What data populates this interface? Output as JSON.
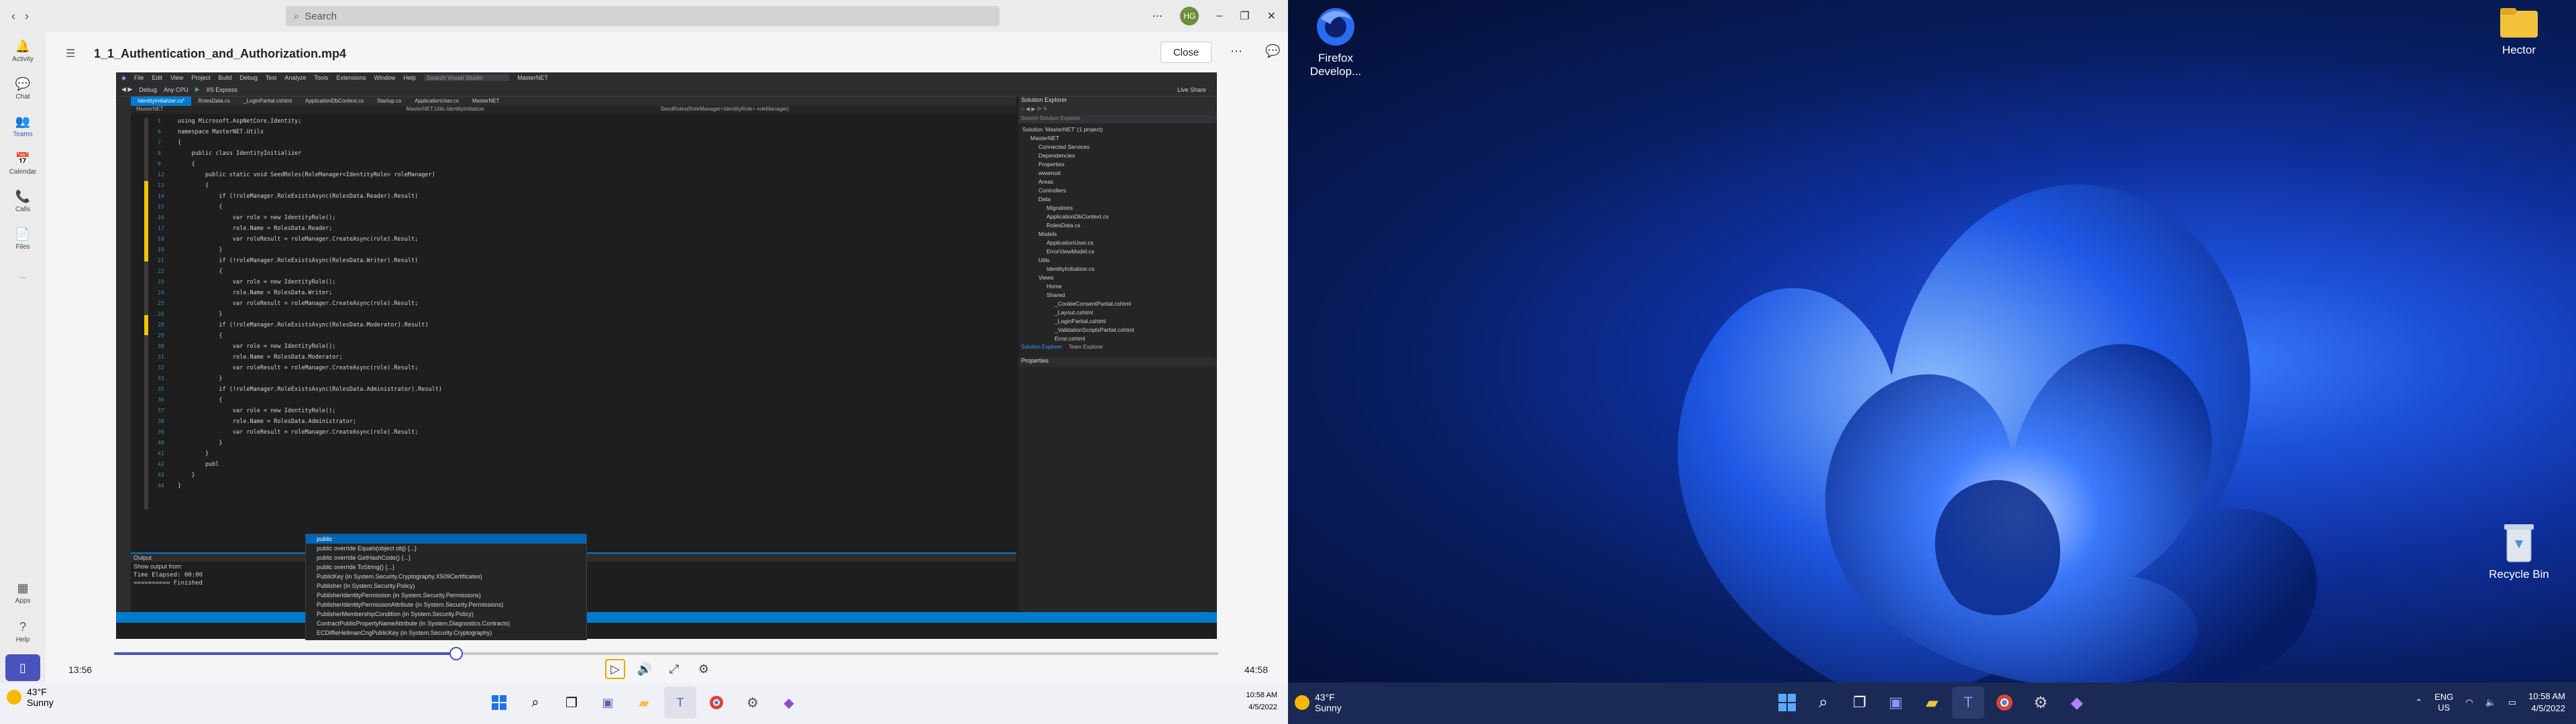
{
  "teams": {
    "search_placeholder": "Search",
    "avatar_initials": "HG",
    "rail": [
      {
        "label": "Activity",
        "glyph": "🔔"
      },
      {
        "label": "Chat",
        "glyph": "💬"
      },
      {
        "label": "Teams",
        "glyph": "👥"
      },
      {
        "label": "Calendar",
        "glyph": "📅"
      },
      {
        "label": "Calls",
        "glyph": "📞"
      },
      {
        "label": "Files",
        "glyph": "📄"
      },
      {
        "label": "...",
        "glyph": ""
      }
    ],
    "rail_bottom": [
      {
        "label": "Apps"
      },
      {
        "label": "Help"
      }
    ],
    "video_title": "1_1_Authentication_and_Authorization.mp4",
    "close_label": "Close",
    "player": {
      "current_time": "13:56",
      "duration": "44:58",
      "progress": 0.31
    }
  },
  "vs": {
    "menu": [
      "File",
      "Edit",
      "View",
      "Project",
      "Build",
      "Debug",
      "Test",
      "Analyze",
      "Tools",
      "Extensions",
      "Window",
      "Help"
    ],
    "search": "Search Visual Studio",
    "solution_name": "MasterNET",
    "config": "Debug",
    "platform": "Any CPU",
    "run_target": "IIS Express",
    "live_share": "Live Share",
    "tabs": [
      "IdentityInitializer.cs*",
      "RolesData.cs",
      "_LoginPartial.cshtml",
      "ApplicationDbContext.cs",
      "Startup.cs",
      "ApplicationUser.cs",
      "MasterNET"
    ],
    "nav_left": "MasterNET",
    "nav_mid": "MasterNET.Utils.IdentityInitializer",
    "nav_right": "SeedRoles(RoleManager<IdentityRole> roleManager)",
    "code": [
      {
        "n": "1",
        "t": "using Microsoft.AspNetCore.Identity;"
      },
      {
        "n": "6",
        "t": "namespace MasterNET.Utils"
      },
      {
        "n": "7",
        "t": "{"
      },
      {
        "n": "8",
        "t": "    public class IdentityInitializer"
      },
      {
        "n": "9",
        "t": "    {"
      },
      {
        "n": "12",
        "t": "        public static void SeedRoles(RoleManager<IdentityRole> roleManager)"
      },
      {
        "n": "13",
        "t": "        {"
      },
      {
        "n": "14",
        "t": "            if (!roleManager.RoleExistsAsync(RolesData.Reader).Result)"
      },
      {
        "n": "15",
        "t": "            {"
      },
      {
        "n": "16",
        "t": "                var role = new IdentityRole();"
      },
      {
        "n": "17",
        "t": "                role.Name = RolesData.Reader;"
      },
      {
        "n": "18",
        "t": "                var roleResult = roleManager.CreateAsync(role).Result;"
      },
      {
        "n": "19",
        "t": "            }"
      },
      {
        "n": "21",
        "t": "            if (!roleManager.RoleExistsAsync(RolesData.Writer).Result)"
      },
      {
        "n": "22",
        "t": "            {"
      },
      {
        "n": "23",
        "t": "                var role = new IdentityRole();"
      },
      {
        "n": "24",
        "t": "                role.Name = RolesData.Writer;"
      },
      {
        "n": "25",
        "t": "                var roleResult = roleManager.CreateAsync(role).Result;"
      },
      {
        "n": "26",
        "t": "            }"
      },
      {
        "n": "28",
        "t": "            if (!roleManager.RoleExistsAsync(RolesData.Moderator).Result)"
      },
      {
        "n": "29",
        "t": "            {"
      },
      {
        "n": "30",
        "t": "                var role = new IdentityRole();"
      },
      {
        "n": "31",
        "t": "                role.Name = RolesData.Moderator;"
      },
      {
        "n": "32",
        "t": "                var roleResult = roleManager.CreateAsync(role).Result;"
      },
      {
        "n": "33",
        "t": "            }"
      },
      {
        "n": "35",
        "t": "            if (!roleManager.RoleExistsAsync(RolesData.Administrator).Result)"
      },
      {
        "n": "36",
        "t": "            {"
      },
      {
        "n": "37",
        "t": "                var role = new IdentityRole();"
      },
      {
        "n": "38",
        "t": "                role.Name = RolesData.Administrator;"
      },
      {
        "n": "39",
        "t": "                var roleResult = roleManager.CreateAsync(role).Result;"
      },
      {
        "n": "40",
        "t": "            }"
      },
      {
        "n": "41",
        "t": "        }"
      },
      {
        "n": "42",
        "t": "        publ"
      },
      {
        "n": "43",
        "t": "    }"
      },
      {
        "n": "44",
        "t": "}"
      }
    ],
    "autocomplete": [
      "public",
      "public override Equals(object obj) {...}",
      "public override GetHashCode() {...}",
      "public override ToString() {...}",
      "PublicKey (in System.Security.Cryptography.X509Certificates)",
      "Publisher (in System.Security.Policy)",
      "PublisherIdentityPermission (in System.Security.Permissions)",
      "PublisherIdentityPermissionAttribute (in System.Security.Permissions)",
      "PublisherMembershipCondition (in System.Security.Policy)",
      "ContractPublicPropertyNameAttribute (in System.Diagnostics.Contracts)",
      "ECDiffieHellmanCngPublicKey (in System.Security.Cryptography)"
    ],
    "zoom": "100 %",
    "output_title": "Output",
    "output_show_from": "Show output from:",
    "output_lines": [
      "Time Elapsed: 00:00",
      "========== Finished"
    ],
    "solution_explorer_title": "Solution Explorer",
    "solution_search": "Search Solution Explorer",
    "tree": [
      {
        "d": 0,
        "t": "Solution 'MasterNET' (1 project)"
      },
      {
        "d": 1,
        "t": "MasterNET"
      },
      {
        "d": 2,
        "t": "Connected Services"
      },
      {
        "d": 2,
        "t": "Dependencies"
      },
      {
        "d": 2,
        "t": "Properties"
      },
      {
        "d": 2,
        "t": "wwwroot"
      },
      {
        "d": 2,
        "t": "Areas"
      },
      {
        "d": 2,
        "t": "Controllers"
      },
      {
        "d": 2,
        "t": "Data"
      },
      {
        "d": 3,
        "t": "Migrations"
      },
      {
        "d": 3,
        "t": "ApplicationDbContext.cs"
      },
      {
        "d": 3,
        "t": "RolesData.cs"
      },
      {
        "d": 2,
        "t": "Models"
      },
      {
        "d": 3,
        "t": "ApplicationUser.cs"
      },
      {
        "d": 3,
        "t": "ErrorViewModel.cs"
      },
      {
        "d": 2,
        "t": "Utils"
      },
      {
        "d": 3,
        "t": "IdentityInitializer.cs"
      },
      {
        "d": 2,
        "t": "Views"
      },
      {
        "d": 3,
        "t": "Home"
      },
      {
        "d": 3,
        "t": "Shared"
      },
      {
        "d": 4,
        "t": "_CookieConsentPartial.cshtml"
      },
      {
        "d": 4,
        "t": "_Layout.cshtml"
      },
      {
        "d": 4,
        "t": "_LoginPartial.cshtml"
      },
      {
        "d": 4,
        "t": "_ValidationScriptsPartial.cshtml"
      },
      {
        "d": 4,
        "t": "Error.cshtml"
      }
    ],
    "se_tabs": [
      "Solution Explorer",
      "Team Explorer"
    ],
    "properties_title": "Properties"
  },
  "taskbar_left": {
    "temp": "43°F",
    "cond": "Sunny",
    "time": "10:58 AM",
    "date": "4/5/2022"
  },
  "desktop": {
    "icons": [
      "Firefox Develop...",
      "Hector",
      "Recycle Bin"
    ]
  },
  "taskbar_right": {
    "temp": "43°F",
    "cond": "Sunny",
    "lang1": "ENG",
    "lang2": "US",
    "time": "10:58 AM",
    "date": "4/5/2022"
  },
  "colors": {
    "teams_accent": "#4b53bc",
    "vs_blue": "#007acc",
    "win_blue": "#1c4fd8"
  }
}
